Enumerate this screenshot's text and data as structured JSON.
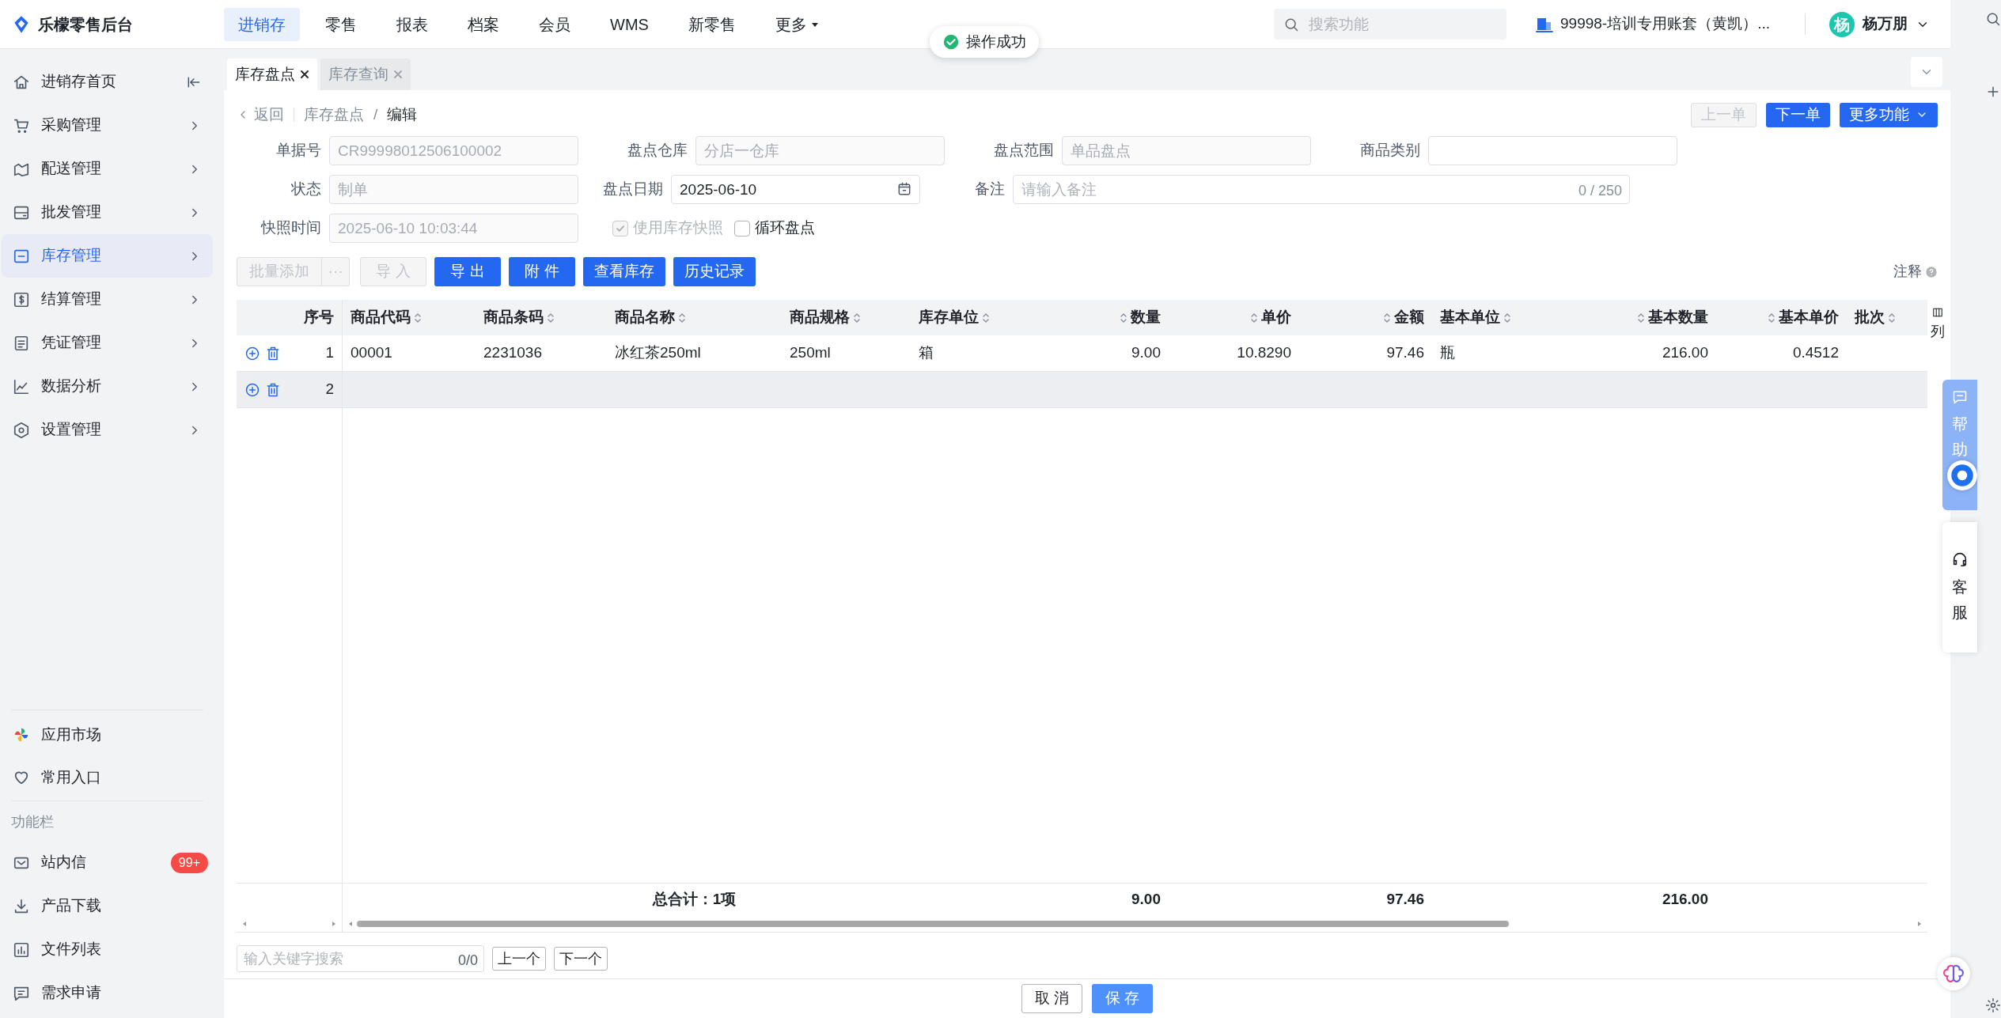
{
  "app": {
    "title": "乐檬零售后台"
  },
  "top_nav": [
    {
      "label": "进销存",
      "selected": true,
      "kind": "link"
    },
    {
      "label": "零售",
      "selected": false,
      "kind": "link"
    },
    {
      "label": "报表",
      "selected": false,
      "kind": "link"
    },
    {
      "label": "档案",
      "selected": false,
      "kind": "link"
    },
    {
      "label": "会员",
      "selected": false,
      "kind": "link"
    },
    {
      "label": "WMS",
      "selected": false,
      "kind": "link"
    },
    {
      "label": "新零售",
      "selected": false,
      "kind": "link"
    },
    {
      "label": "更多",
      "selected": false,
      "kind": "dropdown"
    }
  ],
  "toast": {
    "text": "操作成功"
  },
  "search": {
    "placeholder": "搜索功能"
  },
  "account": {
    "label": "99998-培训专用账套（黄凯）..."
  },
  "user": {
    "avatar_text": "杨",
    "name": "杨万朋"
  },
  "sidebar": {
    "items": [
      {
        "label": "进销存首页",
        "selected": false,
        "kind": "collapse"
      },
      {
        "label": "采购管理",
        "selected": false,
        "kind": "menu"
      },
      {
        "label": "配送管理",
        "selected": false,
        "kind": "menu"
      },
      {
        "label": "批发管理",
        "selected": false,
        "kind": "menu"
      },
      {
        "label": "库存管理",
        "selected": true,
        "kind": "menu"
      },
      {
        "label": "结算管理",
        "selected": false,
        "kind": "menu"
      },
      {
        "label": "凭证管理",
        "selected": false,
        "kind": "menu"
      },
      {
        "label": "数据分析",
        "selected": false,
        "kind": "menu"
      },
      {
        "label": "设置管理",
        "selected": false,
        "kind": "menu"
      }
    ],
    "apps": [
      {
        "label": "应用市场"
      },
      {
        "label": "常用入口"
      }
    ],
    "section_title": "功能栏",
    "tools": [
      {
        "label": "站内信",
        "badge": "99+"
      },
      {
        "label": "产品下载"
      },
      {
        "label": "文件列表"
      },
      {
        "label": "需求申请"
      }
    ]
  },
  "tabs": [
    {
      "label": "库存盘点",
      "selected": true
    },
    {
      "label": "库存查询",
      "selected": false
    }
  ],
  "breadcrumb": {
    "back": "返回",
    "separator": "/",
    "items": [
      "库存盘点",
      "编辑"
    ]
  },
  "nav_buttons": [
    {
      "label": "上一单",
      "disabled": true,
      "kind": "button"
    },
    {
      "label": "下一单",
      "disabled": false,
      "kind": "button"
    },
    {
      "label": "更多功能",
      "disabled": false,
      "kind": "dropdown"
    }
  ],
  "form": {
    "rows": [
      [
        {
          "label": "单据号",
          "value": "CR99998012506100002",
          "disabled": true,
          "kind": "text"
        },
        {
          "label": "盘点仓库",
          "value": "分店一仓库",
          "disabled": true,
          "kind": "text"
        },
        {
          "label": "盘点范围",
          "value": "单品盘点",
          "disabled": true,
          "kind": "text"
        },
        {
          "label": "商品类别",
          "kind": "text"
        }
      ],
      [
        {
          "label": "状态",
          "value": "制单",
          "disabled": true,
          "kind": "text"
        },
        {
          "label": "盘点日期",
          "value": "2025-06-10",
          "disabled": false,
          "kind": "date"
        },
        {
          "label": "备注",
          "placeholder": "请输入备注",
          "counter": "0 / 250",
          "kind": "wide"
        }
      ],
      [
        {
          "label": "快照时间",
          "value": "2025-06-10 10:03:44",
          "disabled": true,
          "kind": "text"
        }
      ]
    ],
    "checkboxes": [
      {
        "label": "使用库存快照",
        "checked": true,
        "disabled": true
      },
      {
        "label": "循环盘点",
        "checked": false,
        "disabled": false
      }
    ]
  },
  "toolbar": [
    {
      "label": "批量添加",
      "disabled": true,
      "kind": "split"
    },
    {
      "label": "···",
      "disabled": true,
      "kind": "more"
    },
    {
      "label": "导 入",
      "disabled": true,
      "kind": "button"
    },
    {
      "label": "导 出",
      "disabled": false,
      "kind": "button"
    },
    {
      "label": "附 件",
      "disabled": false,
      "kind": "button"
    },
    {
      "label": "查看库存",
      "disabled": false,
      "kind": "button"
    },
    {
      "label": "历史记录",
      "disabled": false,
      "kind": "button"
    }
  ],
  "notes_link": "注释",
  "table": {
    "columns": [
      {
        "label": "序号",
        "kind": "number",
        "sortable": false
      },
      {
        "label": "商品代码",
        "kind": "text",
        "sortable": true
      },
      {
        "label": "商品条码",
        "kind": "text",
        "sortable": true
      },
      {
        "label": "商品名称",
        "kind": "text",
        "sortable": true,
        "total": "总合计：1项"
      },
      {
        "label": "商品规格",
        "kind": "text",
        "sortable": true
      },
      {
        "label": "库存单位",
        "kind": "text",
        "sortable": true
      },
      {
        "label": "数量",
        "kind": "number",
        "sortable": true,
        "total": "9.00"
      },
      {
        "label": "单价",
        "kind": "number",
        "sortable": true
      },
      {
        "label": "金额",
        "kind": "number",
        "sortable": true,
        "total": "97.46"
      },
      {
        "label": "基本单位",
        "kind": "text",
        "sortable": true
      },
      {
        "label": "基本数量",
        "kind": "number",
        "sortable": true,
        "total": "216.00"
      },
      {
        "label": "基本单价",
        "kind": "number",
        "sortable": true
      },
      {
        "label": "批次",
        "kind": "text",
        "sortable": true
      }
    ],
    "column_settings": "列",
    "rows": [
      {
        "selected": false,
        "cells": [
          "1",
          "00001",
          "2231036",
          "冰红茶250ml",
          "250ml",
          "箱",
          "9.00",
          "10.8290",
          "97.46",
          "瓶",
          "216.00",
          "0.4512"
        ]
      },
      {
        "selected": true,
        "cells": [
          "2"
        ]
      }
    ]
  },
  "find": {
    "placeholder": "输入关键字搜索",
    "count": "0/0",
    "buttons": [
      "上一个",
      "下一个"
    ]
  },
  "actions": [
    {
      "label": "取 消",
      "kind": "secondary"
    },
    {
      "label": "保 存",
      "kind": "primary"
    }
  ],
  "float_panel": [
    {
      "label": "帮助",
      "kind": "help"
    },
    {
      "label": "客服",
      "kind": "service"
    }
  ]
}
